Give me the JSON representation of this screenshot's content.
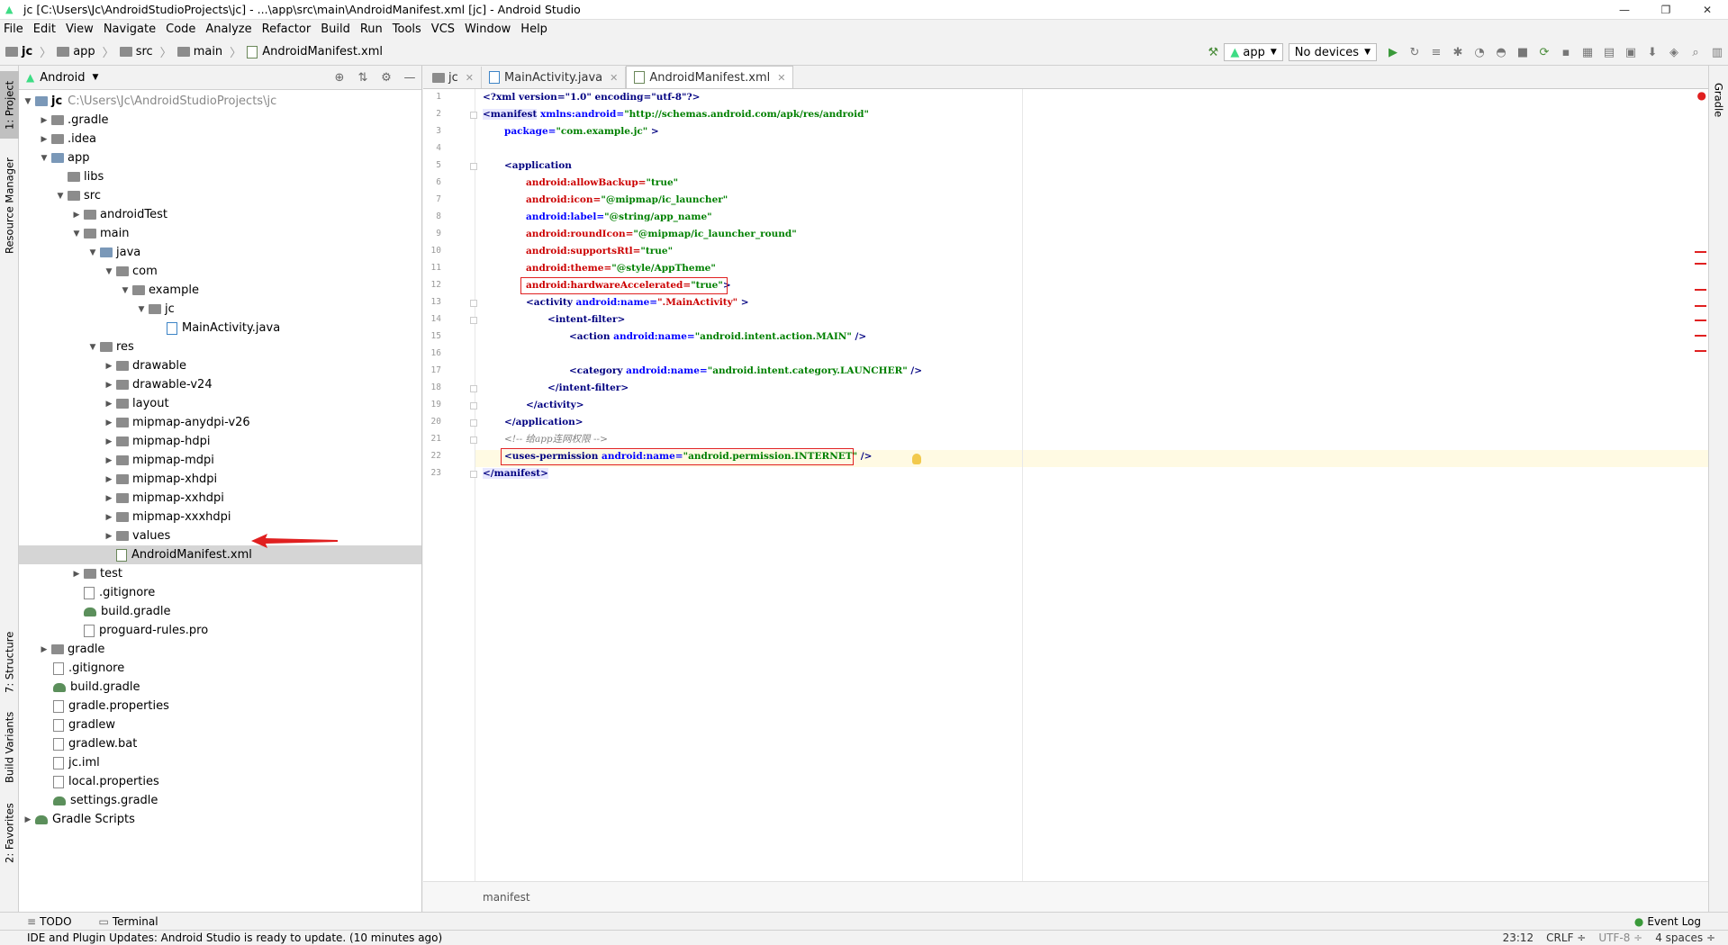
{
  "window": {
    "title": "jc [C:\\Users\\Jc\\AndroidStudioProjects\\jc] - ...\\app\\src\\main\\AndroidManifest.xml [jc] - Android Studio",
    "minimize": "—",
    "restore": "❐",
    "close": "✕"
  },
  "menu": [
    "File",
    "Edit",
    "View",
    "Navigate",
    "Code",
    "Analyze",
    "Refactor",
    "Build",
    "Run",
    "Tools",
    "VCS",
    "Window",
    "Help"
  ],
  "breadcrumbs": [
    "jc",
    "app",
    "src",
    "main",
    "AndroidManifest.xml"
  ],
  "toolbar": {
    "config": "app",
    "device": "No devices"
  },
  "left_tabs": [
    "1: Project",
    "Resource Manager",
    "7: Structure",
    "Build Variants",
    "2: Favorites"
  ],
  "right_tabs": [
    "Gradle"
  ],
  "project": {
    "view": "Android",
    "root": "jc",
    "root_path": "C:\\Users\\Jc\\AndroidStudioProjects\\jc",
    "items": [
      ".gradle",
      ".idea",
      "app",
      "libs",
      "src",
      "androidTest",
      "main",
      "java",
      "com",
      "example",
      "jc",
      "MainActivity.java",
      "res",
      "drawable",
      "drawable-v24",
      "layout",
      "mipmap-anydpi-v26",
      "mipmap-hdpi",
      "mipmap-mdpi",
      "mipmap-xhdpi",
      "mipmap-xxhdpi",
      "mipmap-xxxhdpi",
      "values",
      "AndroidManifest.xml",
      "test",
      ".gitignore",
      "build.gradle",
      "proguard-rules.pro",
      "gradle",
      ".gitignore",
      "build.gradle",
      "gradle.properties",
      "gradlew",
      "gradlew.bat",
      "jc.iml",
      "local.properties",
      "settings.gradle",
      "Gradle Scripts"
    ]
  },
  "editor": {
    "tabs": [
      "jc",
      "MainActivity.java",
      "AndroidManifest.xml"
    ],
    "active_tab": "AndroidManifest.xml",
    "line_numbers": [
      "1",
      "2",
      "3",
      "4",
      "5",
      "6",
      "7",
      "8",
      "9",
      "10",
      "11",
      "12",
      "13",
      "14",
      "15",
      "16",
      "17",
      "18",
      "19",
      "20",
      "21",
      "22",
      "23"
    ],
    "code": {
      "l1": "<?xml version=\"1.0\" encoding=\"utf-8\"?>",
      "l2a": "<manifest",
      "l2b": " xmlns:android=",
      "l2c": "\"http://schemas.android.com/apk/res/android\"",
      "l3a": "package=",
      "l3b": "\"com.example.jc\"",
      "l3c": " >",
      "l5": "<application",
      "l6a": "android:allowBackup=",
      "l6b": "\"true\"",
      "l7a": "android:icon=",
      "l7b": "\"@mipmap/ic_launcher\"",
      "l8a": "android:label=",
      "l8b": "\"@string/app_name\"",
      "l9a": "android:roundIcon=",
      "l9b": "\"@mipmap/ic_launcher_round\"",
      "l10a": "android:supportsRtl=",
      "l10b": "\"true\"",
      "l11a": "android:theme=",
      "l11b": "\"@style/AppTheme\"",
      "l12a": "android:hardwareAccelerated=",
      "l12b": "\"true\"",
      "l12c": ">",
      "l13a": "<activity",
      "l13b": " android:name=",
      "l13c": "\".MainActivity\"",
      "l13d": " >",
      "l14": "<intent-filter>",
      "l15a": "<action",
      "l15b": " android:name=",
      "l15c": "\"android.intent.action.MAIN\"",
      "l15d": " />",
      "l17a": "<category",
      "l17b": " android:name=",
      "l17c": "\"android.intent.category.LAUNCHER\"",
      "l17d": " />",
      "l18": "</intent-filter>",
      "l19": "</activity>",
      "l20": "</application>",
      "l21": "<!-- 给app连网权限 -->",
      "l22a": "<uses-permission",
      "l22b": " android:name=",
      "l22c": "\"android.permission.INTERNET\"",
      "l22d": " />",
      "l23": "</manifest>"
    },
    "breadcrumb": "manifest"
  },
  "bottom_tools": {
    "todo": "TODO",
    "terminal": "Terminal",
    "event_log": "Event Log"
  },
  "status": {
    "message": "IDE and Plugin Updates: Android Studio is ready to update. (10 minutes ago)",
    "position": "23:12",
    "line_sep": "CRLF ÷",
    "encoding": "UTF-8 ÷",
    "indent": "4 spaces ÷"
  },
  "colors": {
    "accent_red": "#e02020",
    "android_green": "#3ddc84"
  }
}
